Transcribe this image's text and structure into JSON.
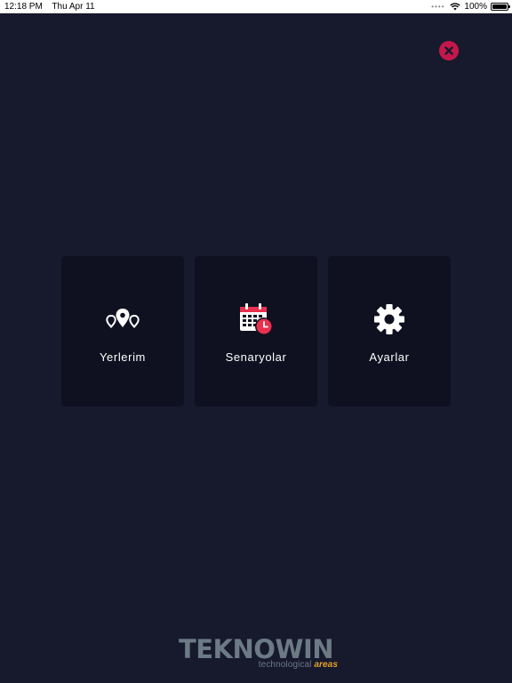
{
  "status_bar": {
    "time": "12:18 PM",
    "date": "Thu Apr 11",
    "battery": "100%",
    "icons": [
      "cellular-dots-icon",
      "wifi-icon",
      "battery-icon"
    ]
  },
  "close_button": {
    "icon": "close-icon",
    "color": "#c4184c"
  },
  "menu": {
    "items": [
      {
        "label": "Yerlerim",
        "icon": "map-pins-icon"
      },
      {
        "label": "Senaryolar",
        "icon": "calendar-clock-icon"
      },
      {
        "label": "Ayarlar",
        "icon": "gear-icon"
      }
    ]
  },
  "logo": {
    "name": "TEKNOWIN",
    "tagline_main": "technological",
    "tagline_accent": "areas",
    "colors": {
      "text": "#6c7a86",
      "accent": "#e7a22b"
    }
  },
  "colors": {
    "background": "#171a2c",
    "card": "#0f1120",
    "text": "#ffffff",
    "highlight": "#e8304f"
  }
}
